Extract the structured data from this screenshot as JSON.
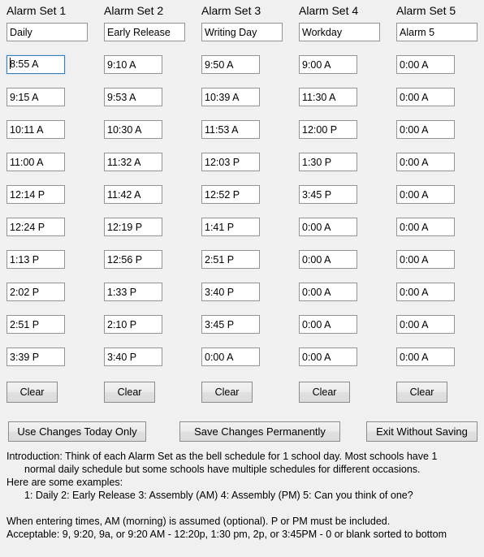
{
  "window": {
    "background_color": "#f0f0f0",
    "focus_border_color": "#3c7fb1"
  },
  "alarm_sets": [
    {
      "title": "Alarm Set 1",
      "name_value": "Daily",
      "clear_label": "Clear",
      "focused_index": 0,
      "times": [
        "8:55 A",
        "9:15 A",
        "10:11 A",
        "11:00 A",
        "12:14 P",
        "12:24 P",
        "1:13 P",
        "2:02 P",
        "2:51 P",
        "3:39 P"
      ]
    },
    {
      "title": "Alarm Set 2",
      "name_value": "Early Release",
      "clear_label": "Clear",
      "focused_index": -1,
      "times": [
        "9:10 A",
        "9:53 A",
        "10:30 A",
        "11:32 A",
        "11:42 A",
        "12:19 P",
        "12:56 P",
        "1:33 P",
        "2:10 P",
        "3:40 P"
      ]
    },
    {
      "title": "Alarm Set 3",
      "name_value": "Writing Day",
      "clear_label": "Clear",
      "focused_index": -1,
      "times": [
        "9:50 A",
        "10:39 A",
        "11:53 A",
        "12:03 P",
        "12:52 P",
        "1:41 P",
        "2:51 P",
        "3:40 P",
        "3:45 P",
        "0:00 A"
      ]
    },
    {
      "title": "Alarm Set 4",
      "name_value": "Workday",
      "clear_label": "Clear",
      "focused_index": -1,
      "times": [
        "9:00 A",
        "11:30 A",
        "12:00 P",
        "1:30 P",
        "3:45 P",
        "0:00 A",
        "0:00 A",
        "0:00 A",
        "0:00 A",
        "0:00 A"
      ]
    },
    {
      "title": "Alarm Set 5",
      "name_value": "Alarm 5",
      "clear_label": "Clear",
      "focused_index": -1,
      "times": [
        "0:00 A",
        "0:00 A",
        "0:00 A",
        "0:00 A",
        "0:00 A",
        "0:00 A",
        "0:00 A",
        "0:00 A",
        "0:00 A",
        "0:00 A"
      ]
    }
  ],
  "actions": {
    "use_today_label": "Use Changes Today Only",
    "save_permanent_label": "Save Changes Permanently",
    "exit_label": "Exit Without Saving"
  },
  "instructions": {
    "line1": "Introduction: Think of each Alarm Set as the bell schedule for 1 school day. Most schools have 1",
    "line2": "normal daily schedule but some schools have multiple schedules for different occasions.",
    "line3": "Here are some examples:",
    "line4": "1: Daily   2: Early Release   3: Assembly (AM)   4: Assembly (PM)   5: Can you think of one?",
    "line5": "When entering times, AM (morning) is assumed (optional).  P or PM must be included.",
    "line6": "Acceptable: 9, 9:20, 9a, or 9:20 AM  -  12:20p, 1:30 pm, 2p, or 3:45PM  -  0 or blank sorted to bottom"
  }
}
